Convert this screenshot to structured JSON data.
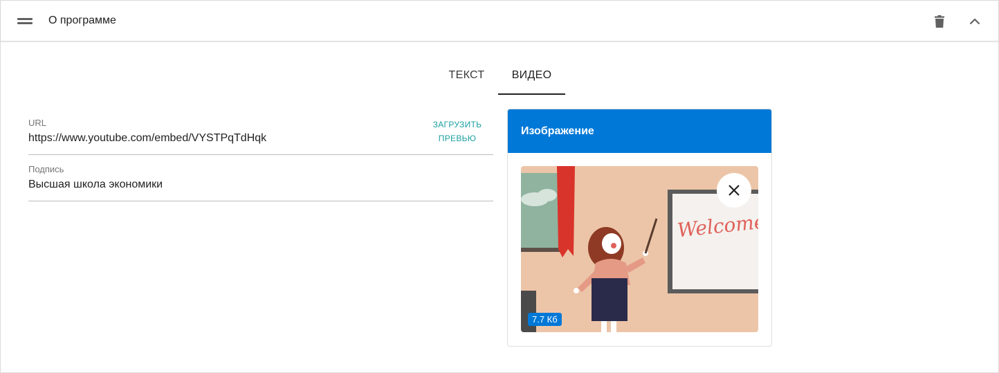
{
  "panel": {
    "title": "О программе",
    "icons": {
      "drag": "drag-handle-icon",
      "delete": "trash-icon",
      "collapse": "chevron-up-icon"
    }
  },
  "tabs": [
    {
      "label": "ТЕКСТ",
      "active": false
    },
    {
      "label": "ВИДЕО",
      "active": true
    }
  ],
  "form": {
    "url_label": "URL",
    "url_value": "https://www.youtube.com/embed/VYSTPqTdHqk",
    "load_preview_label_1": "ЗАГРУЗИТЬ",
    "load_preview_label_2": "ПРЕВЬЮ",
    "caption_label": "Подпись",
    "caption_value": "Высшая школа экономики"
  },
  "image_card": {
    "title": "Изображение",
    "file_size": "7.7 Кб",
    "remove_icon": "close-icon",
    "preview_text": "Welcome"
  },
  "colors": {
    "accent": "#0078d7",
    "link": "#1a9fa0"
  }
}
